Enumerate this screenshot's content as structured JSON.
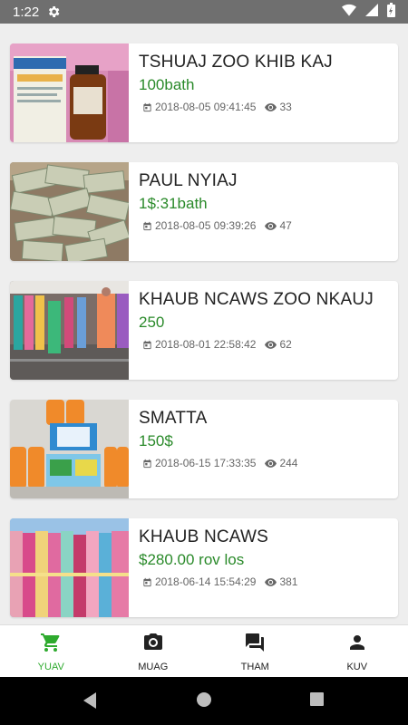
{
  "status_bar": {
    "time": "1:22",
    "icons": [
      "settings-icon",
      "wifi-icon",
      "signal-icon",
      "battery-icon"
    ]
  },
  "listings": [
    {
      "title": "TSHUAJ ZOO KHIB KAJ",
      "price": "100bath",
      "datetime": "2018-08-05 09:41:45",
      "views": "33"
    },
    {
      "title": "PAUL NYIAJ",
      "price": "1$:31bath",
      "datetime": "2018-08-05 09:39:26",
      "views": "47"
    },
    {
      "title": "KHAUB NCAWS ZOO NKAUJ",
      "price": "250",
      "datetime": "2018-08-01 22:58:42",
      "views": "62"
    },
    {
      "title": "SMATTA",
      "price": "150$",
      "datetime": "2018-06-15 17:33:35",
      "views": "244"
    },
    {
      "title": "KHAUB NCAWS",
      "price": "$280.00 rov los",
      "datetime": "2018-06-14 15:54:29",
      "views": "381"
    }
  ],
  "tabs": [
    {
      "label": "YUAV",
      "icon": "cart-icon",
      "active": true
    },
    {
      "label": "MUAG",
      "icon": "camera-icon",
      "active": false
    },
    {
      "label": "THAM",
      "icon": "chat-icon",
      "active": false
    },
    {
      "label": "KUV",
      "icon": "person-icon",
      "active": false
    }
  ],
  "colors": {
    "accent_green": "#2eaa2e",
    "price_green": "#2a8a2a",
    "status_bar": "#6f6f6f"
  }
}
